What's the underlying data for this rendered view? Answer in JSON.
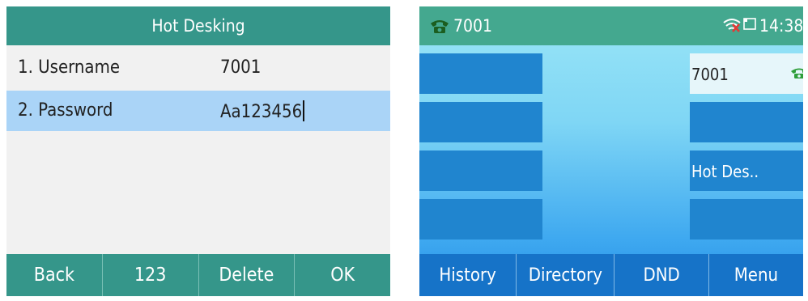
{
  "left_screen": {
    "title": "Hot Desking",
    "fields": [
      {
        "label": "1. Username",
        "value": "7001"
      },
      {
        "label": "2. Password",
        "value": "Aa123456"
      }
    ],
    "softkeys": [
      "Back",
      "123",
      "Delete",
      "OK"
    ]
  },
  "right_screen": {
    "status_bar": {
      "extension": "7001",
      "phone_icon": "phone-icon",
      "wifi_icon": "wifi-off-icon",
      "screen_icon": "tablet-icon",
      "time": "14:38"
    },
    "line_keys_right": [
      {
        "label": "7001",
        "icon": "line-phone-icon"
      },
      {
        "label": ""
      },
      {
        "label": "Hot Des.."
      },
      {
        "label": ""
      }
    ],
    "softkeys": [
      "History",
      "Directory",
      "DND",
      "Menu"
    ]
  },
  "colors": {
    "left_accent": "#35968a",
    "selected_row": "#aad4f7",
    "right_status": "#44a88f",
    "line_key_blue": "#2085cf",
    "softkey_blue": "#1673c8"
  }
}
